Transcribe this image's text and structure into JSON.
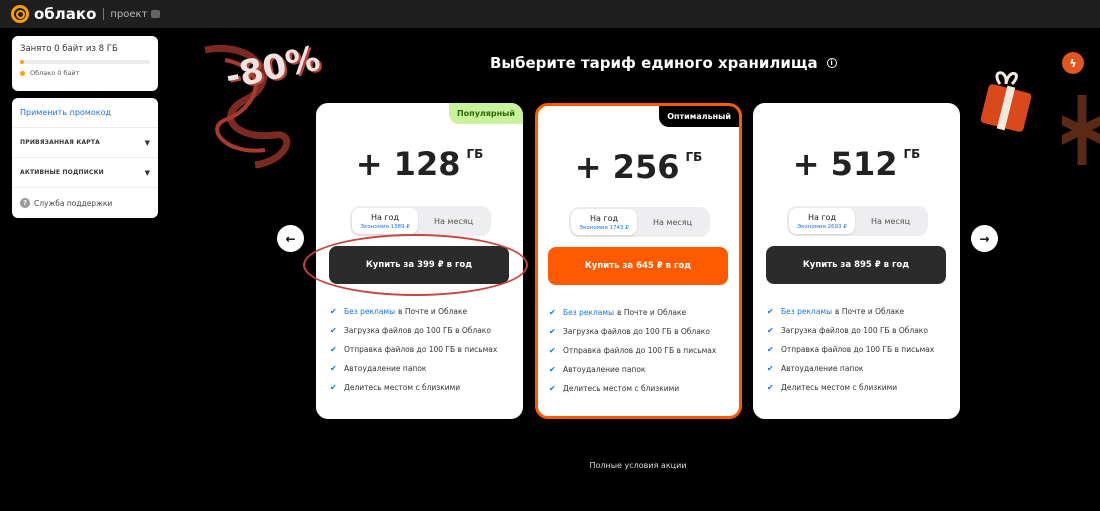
{
  "app": {
    "logo_text": "облако",
    "project_label": "проект"
  },
  "storage": {
    "title": "Занято 0 байт из 8 ГБ",
    "legend": "Облако 0 байт",
    "used_fraction": 0.0
  },
  "sidebar": {
    "promo": "Применить промокод",
    "linked_card": "ПРИВЯЗАННАЯ КАРТА",
    "subscriptions": "АКТИВНЫЕ ПОДПИСКИ",
    "support": "Служба поддержки"
  },
  "heading": "Выберите тариф единого хранилища",
  "decoration": {
    "promo_text": "-80%"
  },
  "plans": [
    {
      "badge": "Популярный",
      "size_num": "+ 128",
      "size_unit": "ГБ",
      "year_label": "На год",
      "year_saving": "Экономия 1389 ₽",
      "month_label": "На месяц",
      "buy_label": "Купить за 399 ₽ в год"
    },
    {
      "badge": "Оптимальный",
      "size_num": "+ 256",
      "size_unit": "ГБ",
      "year_label": "На год",
      "year_saving": "Экономия 1743 ₽",
      "month_label": "На месяц",
      "buy_label": "Купить за 645 ₽ в год"
    },
    {
      "badge": "",
      "size_num": "+ 512",
      "size_unit": "ГБ",
      "year_label": "На год",
      "year_saving": "Экономия 2693 ₽",
      "month_label": "На месяц",
      "buy_label": "Купить за 895 ₽ в год"
    }
  ],
  "features": {
    "f1_link": "Без рекламы",
    "f1_rest": "в Почте и Облаке",
    "f2": "Загрузка файлов до 100 ГБ в Облако",
    "f3": "Отправка файлов до 100 ГБ в письмах",
    "f4": "Автоудаление папок",
    "f5": "Делитесь местом с близкими"
  },
  "terms_link": "Полные условия акции",
  "colors": {
    "accent_orange": "#ff5a00",
    "logo_orange": "#ff9e00",
    "popular_badge": "#c8f29b",
    "link_blue": "#1a73e8"
  }
}
